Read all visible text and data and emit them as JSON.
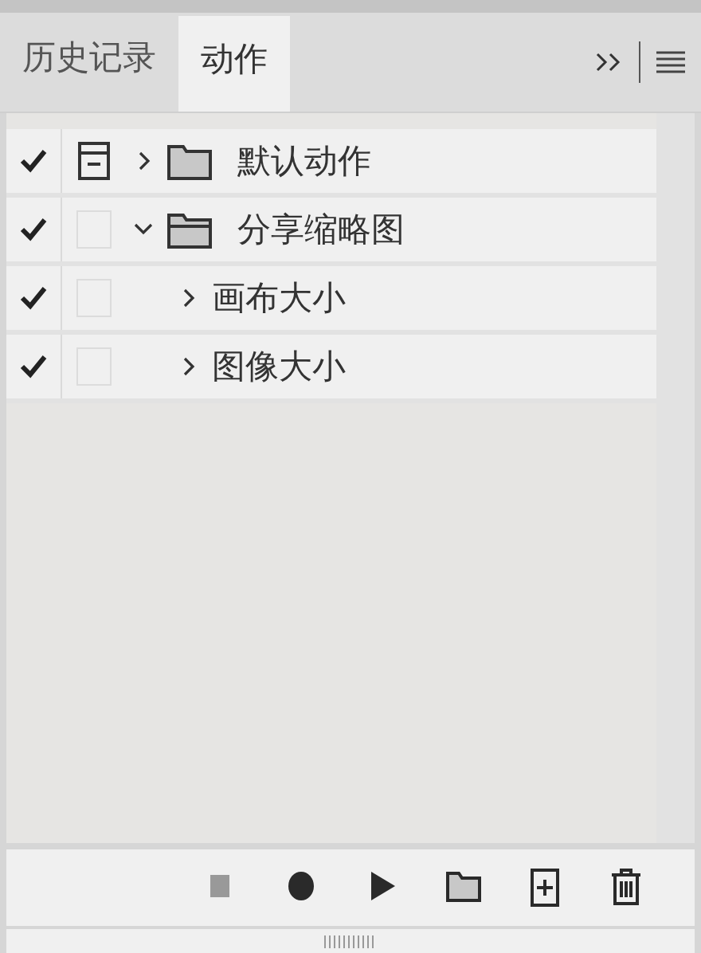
{
  "tabs": [
    {
      "label": "历史记录",
      "selected": false
    },
    {
      "label": "动作",
      "selected": true
    }
  ],
  "sets": [
    {
      "kind": "set",
      "name": "默认动作",
      "checked": true,
      "dialog": true,
      "expanded": false
    },
    {
      "kind": "set",
      "name": "分享缩略图",
      "checked": true,
      "dialog": false,
      "expanded": true,
      "children": [
        {
          "kind": "action",
          "name": "画布大小",
          "checked": true,
          "dialog": false,
          "expanded": false
        },
        {
          "kind": "action",
          "name": "图像大小",
          "checked": true,
          "dialog": false,
          "expanded": false
        }
      ]
    }
  ],
  "toolbar": [
    {
      "kind": "stop",
      "disabled": true
    },
    {
      "kind": "record",
      "disabled": false
    },
    {
      "kind": "play",
      "disabled": false
    },
    {
      "kind": "new-set",
      "disabled": false
    },
    {
      "kind": "new-action",
      "disabled": false
    },
    {
      "kind": "delete",
      "disabled": false
    }
  ]
}
